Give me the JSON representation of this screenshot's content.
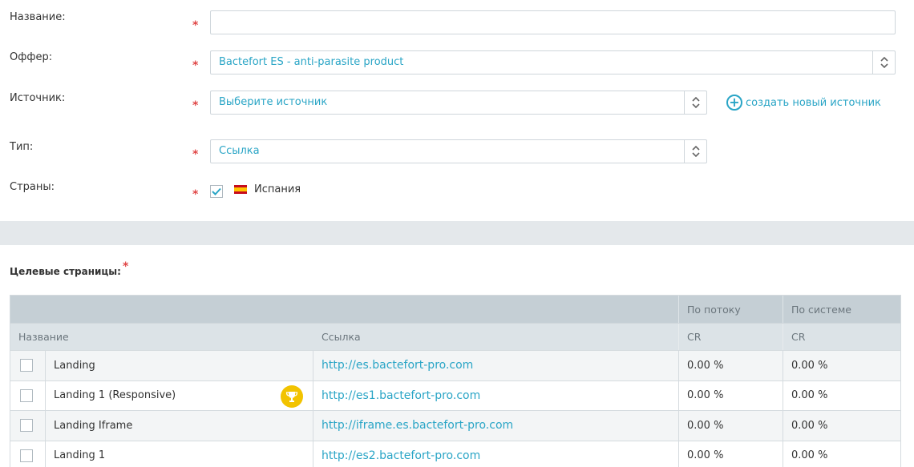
{
  "form": {
    "name": {
      "label": "Название:",
      "required_mark": "*",
      "value": ""
    },
    "offer": {
      "label": "Оффер:",
      "required_mark": "*",
      "value": "Bactefort ES - anti-parasite product"
    },
    "source": {
      "label": "Источник:",
      "required_mark": "*",
      "value": "Выберите источник",
      "create_link": "создать новый источник"
    },
    "type": {
      "label": "Тип:",
      "required_mark": "*",
      "value": "Ссылка"
    },
    "countries": {
      "label": "Страны:",
      "required_mark": "*",
      "selected": "Испания",
      "checked": true
    }
  },
  "landing_section": {
    "title": "Целевые страницы:",
    "required_mark": "*",
    "header_group": {
      "by_flow": "По потоку",
      "by_system": "По системе"
    },
    "columns": {
      "name": "Название",
      "link": "Ссылка",
      "cr_flow": "CR",
      "cr_system": "CR"
    },
    "rows": [
      {
        "name": "Landing",
        "link": "http://es.bactefort-pro.com",
        "cr_flow": "0.00 %",
        "cr_system": "0.00 %",
        "trophy": false
      },
      {
        "name": "Landing 1 (Responsive)",
        "link": "http://es1.bactefort-pro.com",
        "cr_flow": "0.00 %",
        "cr_system": "0.00 %",
        "trophy": true
      },
      {
        "name": "Landing Iframe",
        "link": "http://iframe.es.bactefort-pro.com",
        "cr_flow": "0.00 %",
        "cr_system": "0.00 %",
        "trophy": false
      },
      {
        "name": "Landing 1",
        "link": "http://es2.bactefort-pro.com",
        "cr_flow": "0.00 %",
        "cr_system": "0.00 %",
        "trophy": false
      }
    ]
  },
  "colors": {
    "accent": "#2aa5c6",
    "required": "#e04545",
    "trophy": "#f2c300"
  },
  "icons": {
    "select_arrows": "up-down-chevron-icon",
    "create": "plus-circle-icon",
    "flag": "spain-flag-icon",
    "trophy": "trophy-icon",
    "check": "check-icon"
  }
}
